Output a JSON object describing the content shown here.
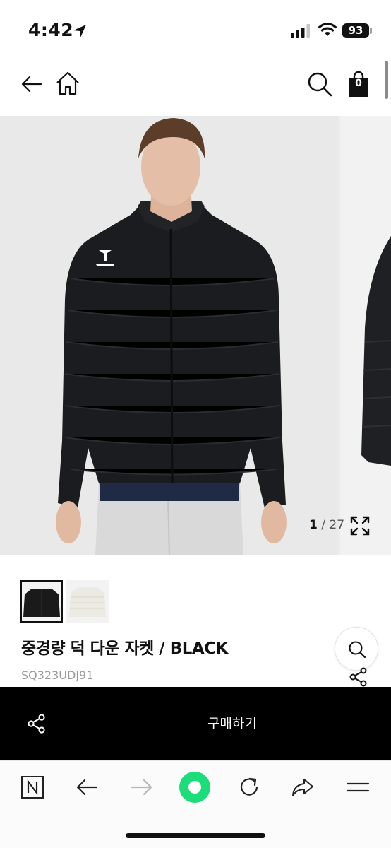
{
  "status_bar": {
    "time": "4:42",
    "battery": "93"
  },
  "header": {
    "cart_count": "0",
    "icons": [
      "back-arrow-icon",
      "home-icon",
      "search-icon",
      "shopping-bag-icon"
    ]
  },
  "gallery": {
    "current": "1",
    "total": "/ 27",
    "main_image": "product-photo-model-black-jacket",
    "next_image": "product-photo-jacket-flat"
  },
  "thumbnails": [
    {
      "color": "BLACK",
      "swatch": "#1a1a1a"
    },
    {
      "color": "IVORY",
      "swatch": "#ecebe3"
    }
  ],
  "product": {
    "name": "중경량 덕 다운 자켓 / BLACK",
    "code": "SQ323UDJ91"
  },
  "buy_bar": {
    "buy_label": "구매하기"
  },
  "browser_bar": {
    "icons": [
      "naver-icon",
      "back-icon",
      "forward-icon",
      "green-circle-icon",
      "reload-icon",
      "share-icon",
      "menu-icon"
    ],
    "accent": "#1ddc7a"
  },
  "colors": {
    "buy_bar_bg": "#000000",
    "accent_green": "#1ddc7a"
  }
}
